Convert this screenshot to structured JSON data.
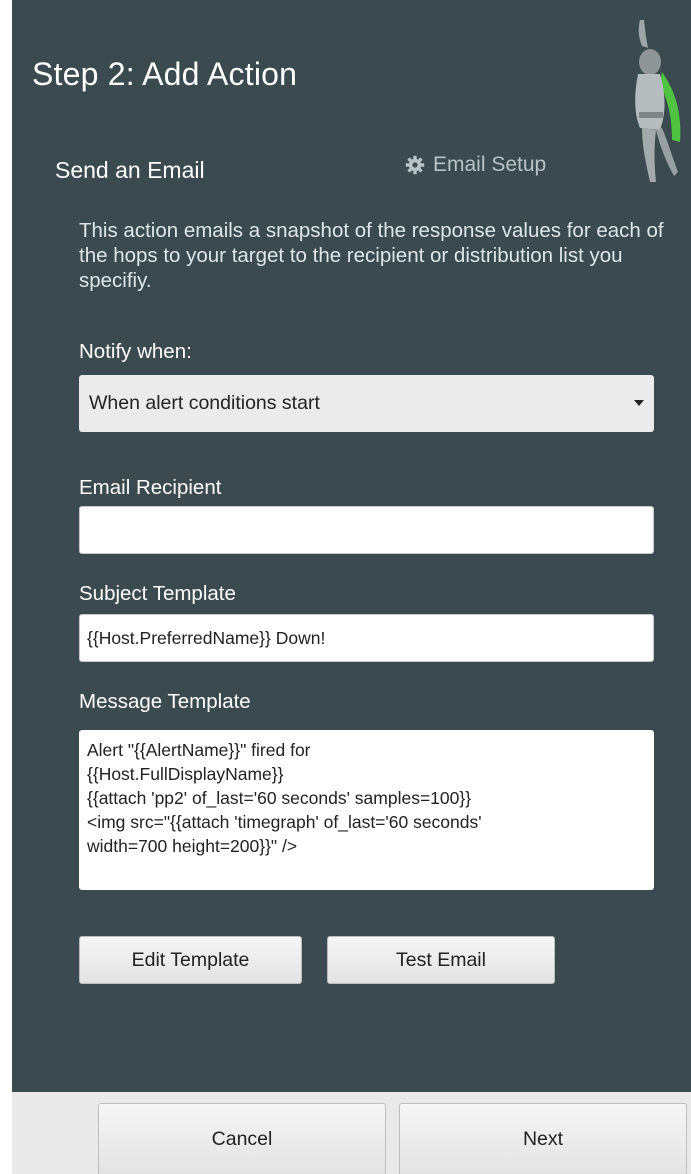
{
  "header": {
    "step_title": "Step 2:  Add Action"
  },
  "section": {
    "title": "Send an Email",
    "email_setup_label": "Email Setup",
    "description": "This action emails a snapshot of the response values for each of the hops to your target to the recipient or distribution list you specifiy."
  },
  "form": {
    "notify_label": "Notify when:",
    "notify_value": "When alert conditions start",
    "recipient_label": "Email Recipient",
    "recipient_value": "",
    "subject_label": "Subject Template",
    "subject_value": "{{Host.PreferredName}} Down!",
    "message_label": "Message Template",
    "message_value": "Alert \"{{AlertName}}\" fired for\n{{Host.FullDisplayName}}\n{{attach 'pp2' of_last='60 seconds' samples=100}}\n<img src=\"{{attach 'timegraph' of_last='60 seconds'\nwidth=700 height=200}}\" />",
    "edit_template_label": "Edit Template",
    "test_email_label": "Test Email"
  },
  "footer": {
    "cancel_label": "Cancel",
    "next_label": "Next"
  },
  "icons": {
    "email_setup": "gear-icon",
    "notify_dropdown": "caret-down-icon",
    "mascot": "superhero-mascot-icon"
  },
  "colors": {
    "panel_background": "#3b4a4e",
    "footer_background": "#e9e9e9",
    "mascot_accent": "#4fc341"
  }
}
